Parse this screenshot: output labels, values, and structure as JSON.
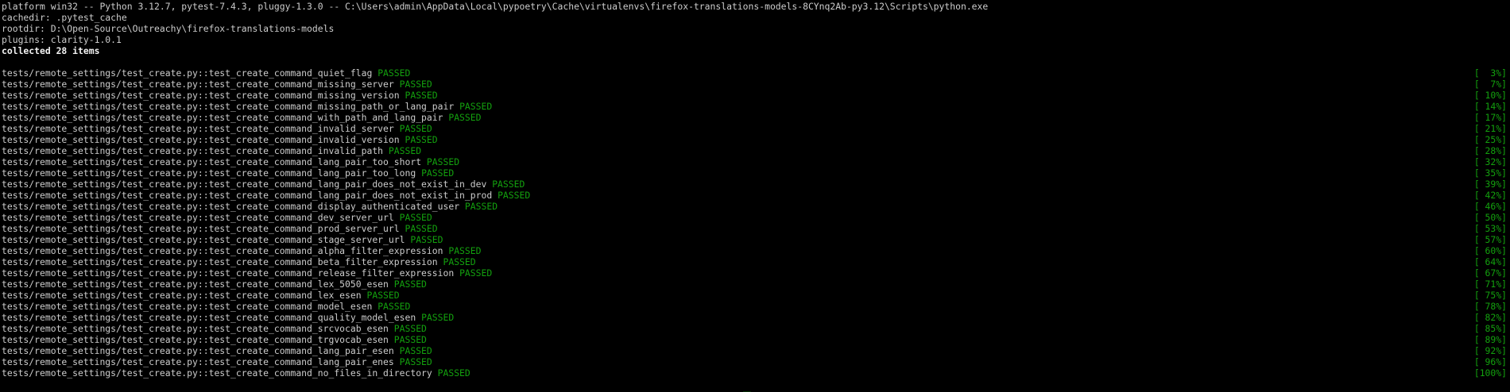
{
  "header": {
    "platform": "platform win32 -- Python 3.12.7, pytest-7.4.3, pluggy-1.3.0 -- C:\\Users\\admin\\AppData\\Local\\pypoetry\\Cache\\virtualenvs\\firefox-translations-models-8CYnq2Ab-py3.12\\Scripts\\python.exe",
    "cachedir": "cachedir: .pytest_cache",
    "rootdir": "rootdir: D:\\Open-Source\\Outreachy\\firefox-translations-models",
    "plugins": "plugins: clarity-1.0.1",
    "collected": "collected 28 items"
  },
  "colors": {
    "background": "#000000",
    "text": "#cccccc",
    "pass_green": "#13a10e"
  },
  "tests": [
    {
      "name": "tests/remote_settings/test_create.py::test_create_command_quiet_flag",
      "status": "PASSED",
      "progress": "[  3%]"
    },
    {
      "name": "tests/remote_settings/test_create.py::test_create_command_missing_server",
      "status": "PASSED",
      "progress": "[  7%]"
    },
    {
      "name": "tests/remote_settings/test_create.py::test_create_command_missing_version",
      "status": "PASSED",
      "progress": "[ 10%]"
    },
    {
      "name": "tests/remote_settings/test_create.py::test_create_command_missing_path_or_lang_pair",
      "status": "PASSED",
      "progress": "[ 14%]"
    },
    {
      "name": "tests/remote_settings/test_create.py::test_create_command_with_path_and_lang_pair",
      "status": "PASSED",
      "progress": "[ 17%]"
    },
    {
      "name": "tests/remote_settings/test_create.py::test_create_command_invalid_server",
      "status": "PASSED",
      "progress": "[ 21%]"
    },
    {
      "name": "tests/remote_settings/test_create.py::test_create_command_invalid_version",
      "status": "PASSED",
      "progress": "[ 25%]"
    },
    {
      "name": "tests/remote_settings/test_create.py::test_create_command_invalid_path",
      "status": "PASSED",
      "progress": "[ 28%]"
    },
    {
      "name": "tests/remote_settings/test_create.py::test_create_command_lang_pair_too_short",
      "status": "PASSED",
      "progress": "[ 32%]"
    },
    {
      "name": "tests/remote_settings/test_create.py::test_create_command_lang_pair_too_long",
      "status": "PASSED",
      "progress": "[ 35%]"
    },
    {
      "name": "tests/remote_settings/test_create.py::test_create_command_lang_pair_does_not_exist_in_dev",
      "status": "PASSED",
      "progress": "[ 39%]"
    },
    {
      "name": "tests/remote_settings/test_create.py::test_create_command_lang_pair_does_not_exist_in_prod",
      "status": "PASSED",
      "progress": "[ 42%]"
    },
    {
      "name": "tests/remote_settings/test_create.py::test_create_command_display_authenticated_user",
      "status": "PASSED",
      "progress": "[ 46%]"
    },
    {
      "name": "tests/remote_settings/test_create.py::test_create_command_dev_server_url",
      "status": "PASSED",
      "progress": "[ 50%]"
    },
    {
      "name": "tests/remote_settings/test_create.py::test_create_command_prod_server_url",
      "status": "PASSED",
      "progress": "[ 53%]"
    },
    {
      "name": "tests/remote_settings/test_create.py::test_create_command_stage_server_url",
      "status": "PASSED",
      "progress": "[ 57%]"
    },
    {
      "name": "tests/remote_settings/test_create.py::test_create_command_alpha_filter_expression",
      "status": "PASSED",
      "progress": "[ 60%]"
    },
    {
      "name": "tests/remote_settings/test_create.py::test_create_command_beta_filter_expression",
      "status": "PASSED",
      "progress": "[ 64%]"
    },
    {
      "name": "tests/remote_settings/test_create.py::test_create_command_release_filter_expression",
      "status": "PASSED",
      "progress": "[ 67%]"
    },
    {
      "name": "tests/remote_settings/test_create.py::test_create_command_lex_5050_esen",
      "status": "PASSED",
      "progress": "[ 71%]"
    },
    {
      "name": "tests/remote_settings/test_create.py::test_create_command_lex_esen",
      "status": "PASSED",
      "progress": "[ 75%]"
    },
    {
      "name": "tests/remote_settings/test_create.py::test_create_command_model_esen",
      "status": "PASSED",
      "progress": "[ 78%]"
    },
    {
      "name": "tests/remote_settings/test_create.py::test_create_command_quality_model_esen",
      "status": "PASSED",
      "progress": "[ 82%]"
    },
    {
      "name": "tests/remote_settings/test_create.py::test_create_command_srcvocab_esen",
      "status": "PASSED",
      "progress": "[ 85%]"
    },
    {
      "name": "tests/remote_settings/test_create.py::test_create_command_trgvocab_esen",
      "status": "PASSED",
      "progress": "[ 89%]"
    },
    {
      "name": "tests/remote_settings/test_create.py::test_create_command_lang_pair_esen",
      "status": "PASSED",
      "progress": "[ 92%]"
    },
    {
      "name": "tests/remote_settings/test_create.py::test_create_command_lang_pair_enes",
      "status": "PASSED",
      "progress": "[ 96%]"
    },
    {
      "name": "tests/remote_settings/test_create.py::test_create_command_no_files_in_directory",
      "status": "PASSED",
      "progress": "[100%]"
    }
  ]
}
